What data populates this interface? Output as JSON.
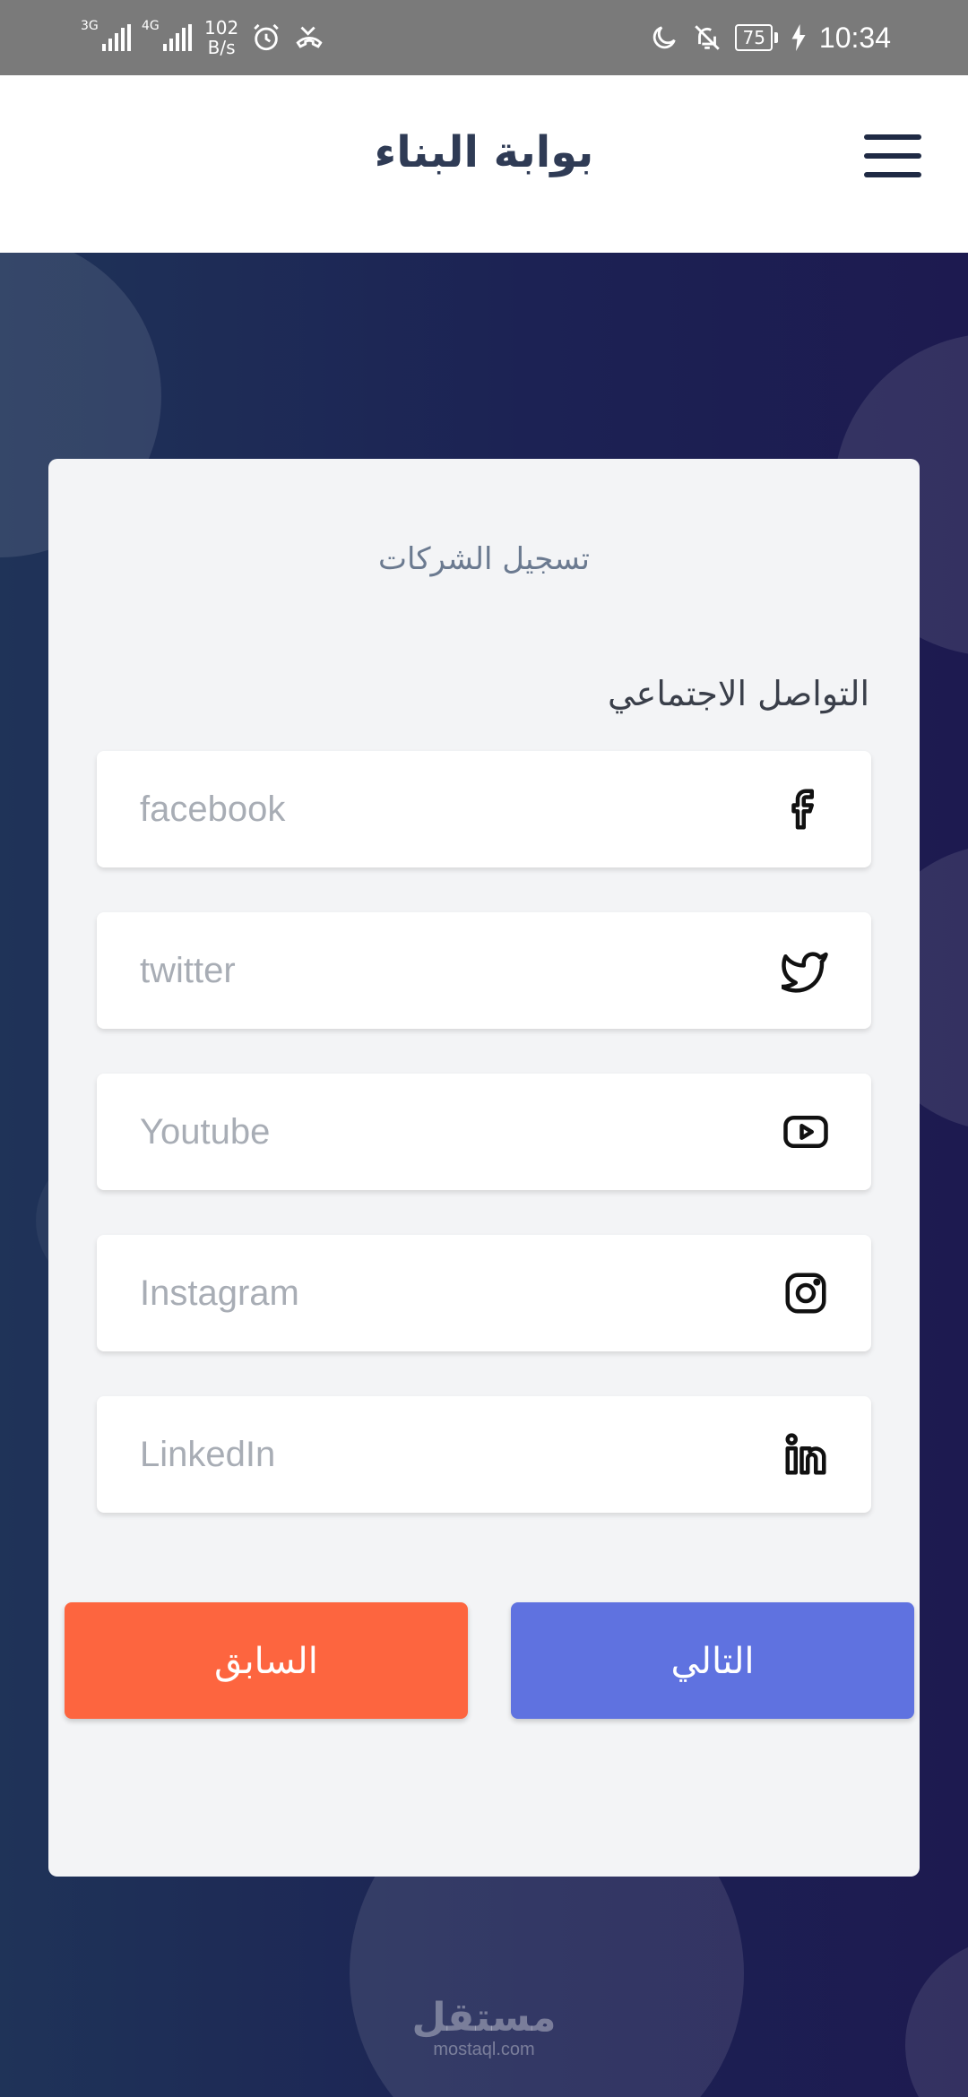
{
  "status_bar": {
    "sim1_tag": "3G",
    "sim2_tag": "4G",
    "net_speed_value": "102",
    "net_speed_unit": "B/s",
    "battery": "75",
    "time": "10:34",
    "icons": [
      "alarm-icon",
      "missed-call-icon",
      "moon-icon",
      "bell-off-icon",
      "charging-icon"
    ]
  },
  "header": {
    "title": "بوابة البناء"
  },
  "card": {
    "title": "تسجيل الشركات",
    "section_label": "التواصل الاجتماعي",
    "fields": [
      {
        "placeholder": "facebook",
        "icon": "facebook-icon"
      },
      {
        "placeholder": "twitter",
        "icon": "twitter-icon"
      },
      {
        "placeholder": "Youtube",
        "icon": "youtube-icon"
      },
      {
        "placeholder": "Instagram",
        "icon": "instagram-icon"
      },
      {
        "placeholder": "LinkedIn",
        "icon": "linkedin-icon"
      }
    ],
    "prev_label": "السابق",
    "next_label": "التالي"
  },
  "colors": {
    "prev_button": "#fd653f",
    "next_button": "#5f72e0",
    "header_title": "#2f3b55",
    "background": "#1e2350"
  },
  "watermark": {
    "logo": "مستقل",
    "url": "mostaql.com"
  }
}
